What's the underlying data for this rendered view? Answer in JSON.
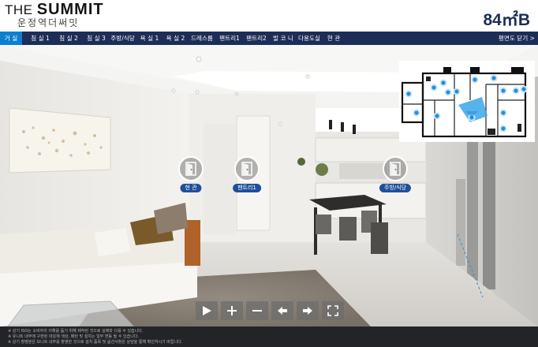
{
  "brand": {
    "title_prefix": "THE ",
    "title_main": "SUMMIT",
    "subtitle": "운정역더써밋"
  },
  "unit_type": "84㎡B",
  "nav": {
    "items": [
      {
        "label": "거 실",
        "active": true
      },
      {
        "label": "침 실 1"
      },
      {
        "label": "침 실 2"
      },
      {
        "label": "침 실 3"
      },
      {
        "label": "주방/식당"
      },
      {
        "label": "욕 실 1"
      },
      {
        "label": "욕 실 2"
      },
      {
        "label": "드레스룸"
      },
      {
        "label": "팬트리1"
      },
      {
        "label": "팬트리2"
      },
      {
        "label": "발 코 니"
      },
      {
        "label": "다용도실"
      },
      {
        "label": "현 관"
      }
    ],
    "close_plan": "평면도 닫기 >"
  },
  "hotspots": [
    {
      "label": "현 관",
      "icon": "door-icon"
    },
    {
      "label": "팬트리1",
      "icon": "door-icon"
    },
    {
      "label": "주방/식당",
      "icon": "door-icon"
    }
  ],
  "controls": [
    "play-icon",
    "zoom-in-icon",
    "zoom-out-icon",
    "arrow-left-icon",
    "arrow-right-icon",
    "fullscreen-icon"
  ],
  "footer": {
    "lines": [
      "※ 상기 ISO는 소비자의 이해를 돕기 위해 제작된 것으로 실제와 다를 수 있습니다.",
      "※ 유니트 내부에 구현된 마감재 색상, 패턴 및 설치는 일부 변동 될 수 있습니다.",
      "※ 상기 촬영분은 모니트 내부를 촬영한 것으로 설치 품목 및 옵션사항은 상담을 통해 확인하시기 바랍니다."
    ]
  },
  "colors": {
    "nav_bg": "#1c2d57",
    "nav_active": "#0b7fd0",
    "hotspot_tag": "#1e4f9c",
    "unit_type": "#1b2e55",
    "footer_bg": "#232427",
    "minimap_marker": "#1f8fe0"
  }
}
